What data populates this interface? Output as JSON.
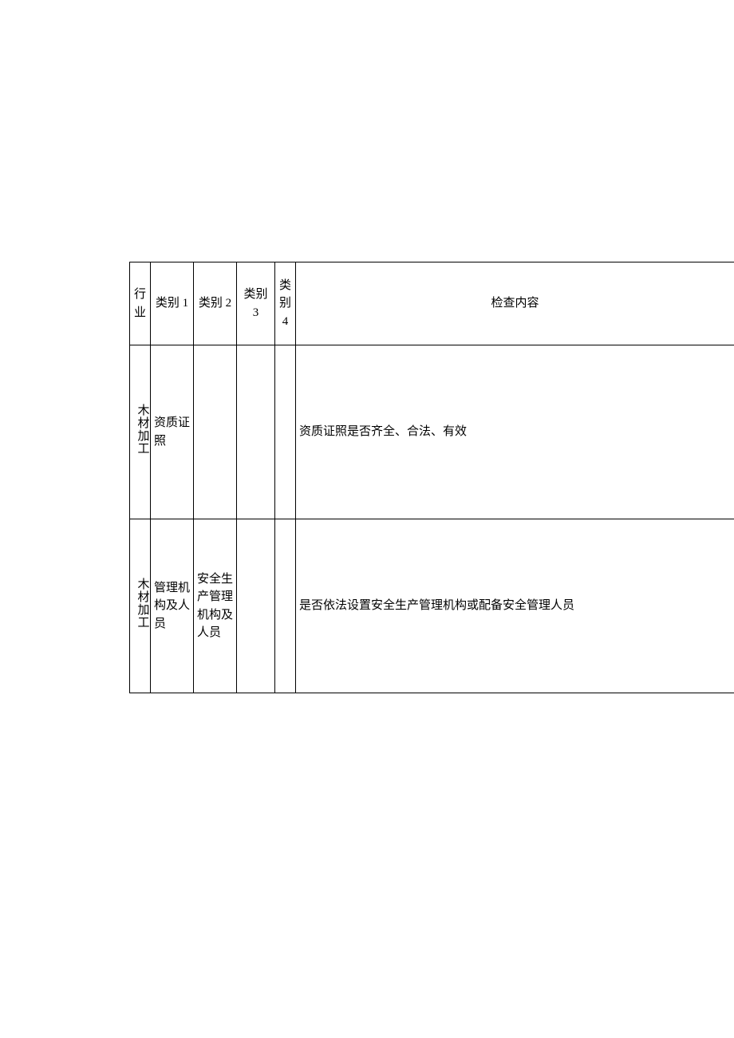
{
  "headers": {
    "industry": "行业",
    "cat1": "类别 1",
    "cat2": "类别 2",
    "cat3": "类别 3",
    "cat4": "类别4",
    "content": "检查内容"
  },
  "rows": [
    {
      "industry": "木材加工",
      "cat1": "资质证照",
      "cat2": "",
      "cat3": "",
      "cat4": "",
      "content": "资质证照是否齐全、合法、有效"
    },
    {
      "industry": "木材加工",
      "cat1": "管理机构及人员",
      "cat2": "安全生产管理机构及人员",
      "cat3": "",
      "cat4": "",
      "content": "是否依法设置安全生产管理机构或配备安全管理人员"
    }
  ]
}
